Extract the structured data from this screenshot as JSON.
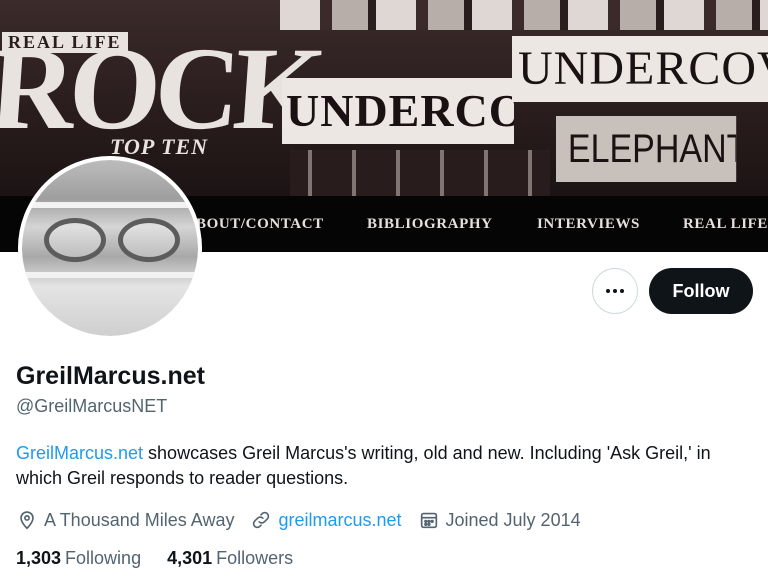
{
  "banner": {
    "art_text": {
      "rock": "ROCK",
      "real_life": "REAL LIFE",
      "top_ten": "TOP TEN",
      "undercover_middle": "UNDERCOV",
      "undercover_right": "UNDERCOV",
      "elephant": "ELEPHANT D"
    },
    "nav": [
      {
        "label": "BOUT/CONTACT"
      },
      {
        "label": "BIBLIOGRAPHY"
      },
      {
        "label": "INTERVIEWS"
      },
      {
        "label": "REAL LIFE"
      }
    ]
  },
  "profile": {
    "display_name": "GreilMarcus.net",
    "handle": "@GreilMarcusNET",
    "bio": {
      "link_text": "GreilMarcus.net",
      "text": " showcases Greil Marcus's writing, old and new. Including 'Ask Greil,' in which Greil responds to reader questions."
    },
    "location": "A Thousand Miles Away",
    "website": "greilmarcus.net",
    "joined": "Joined July 2014",
    "following_count": "1,303",
    "following_label": "Following",
    "followers_count": "4,301",
    "followers_label": "Followers"
  },
  "actions": {
    "more_icon": "more-horizontal-icon",
    "follow_label": "Follow"
  },
  "colors": {
    "accent": "#1d9bf0",
    "primary_text": "#0f1419",
    "secondary_text": "#536471",
    "follow_bg": "#0f1419"
  }
}
